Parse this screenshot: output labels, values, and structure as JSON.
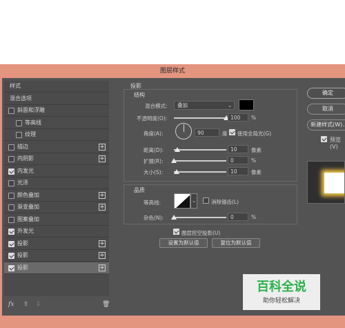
{
  "dialog": {
    "title": "图层样式"
  },
  "left_panel": {
    "items": [
      {
        "label": "样式",
        "has_checkbox": false,
        "checked": false,
        "has_plus": false
      },
      {
        "label": "混合选项",
        "has_checkbox": false,
        "checked": false,
        "has_plus": false
      },
      {
        "label": "斜面和浮雕",
        "has_checkbox": true,
        "checked": false,
        "has_plus": false
      },
      {
        "label": "等高线",
        "has_checkbox": true,
        "checked": false,
        "has_plus": false,
        "indent": true
      },
      {
        "label": "纹理",
        "has_checkbox": true,
        "checked": false,
        "has_plus": false,
        "indent": true
      },
      {
        "label": "描边",
        "has_checkbox": true,
        "checked": false,
        "has_plus": true
      },
      {
        "label": "内阴影",
        "has_checkbox": true,
        "checked": false,
        "has_plus": true
      },
      {
        "label": "内发光",
        "has_checkbox": true,
        "checked": true,
        "has_plus": false
      },
      {
        "label": "光泽",
        "has_checkbox": true,
        "checked": false,
        "has_plus": false
      },
      {
        "label": "颜色叠加",
        "has_checkbox": true,
        "checked": false,
        "has_plus": true
      },
      {
        "label": "渐变叠加",
        "has_checkbox": true,
        "checked": false,
        "has_plus": true
      },
      {
        "label": "图案叠加",
        "has_checkbox": true,
        "checked": false,
        "has_plus": false
      },
      {
        "label": "外发光",
        "has_checkbox": true,
        "checked": true,
        "has_plus": false
      },
      {
        "label": "投影",
        "has_checkbox": true,
        "checked": true,
        "has_plus": true
      },
      {
        "label": "投影",
        "has_checkbox": true,
        "checked": true,
        "has_plus": true
      },
      {
        "label": "投影",
        "has_checkbox": true,
        "checked": true,
        "has_plus": true,
        "selected": true
      }
    ],
    "footer": {
      "fx": "fx",
      "up": "⇧",
      "down": "⇩",
      "trash": "🗑"
    }
  },
  "shadow": {
    "section_title": "投影",
    "structure_title": "结构",
    "blend_mode_label": "混合模式:",
    "blend_mode_value": "叠加",
    "blend_color": "#000000",
    "opacity_label": "不透明度(O):",
    "opacity_value": "100",
    "opacity_unit": "%",
    "opacity_level": 1.0,
    "angle_label": "角度(A):",
    "angle_value": "90",
    "angle_unit": "度",
    "global_light_label": "使用全局光(G)",
    "global_light_checked": true,
    "distance_label": "距离(D):",
    "distance_value": "10",
    "distance_unit": "像素",
    "distance_level": 0.07,
    "spread_label": "扩展(R):",
    "spread_value": "0",
    "spread_unit": "%",
    "spread_level": 0.0,
    "size_label": "大小(S):",
    "size_value": "10",
    "size_unit": "像素",
    "size_level": 0.05,
    "quality_title": "品质",
    "contour_label": "等高线:",
    "antialias_label": "消除锯齿(L)",
    "antialias_checked": false,
    "noise_label": "杂色(N):",
    "noise_value": "0",
    "noise_unit": "%",
    "noise_level": 0.0,
    "knockout_label": "图层挖空投影(U)",
    "knockout_checked": true,
    "set_default_label": "设置为默认值",
    "reset_default_label": "复位为默认值"
  },
  "right_panel": {
    "ok_label": "确定",
    "cancel_label": "取消",
    "new_style_label": "新建样式(W)...",
    "preview_label": "预览(V)",
    "preview_checked": true,
    "glow_color": "#f3c544"
  },
  "watermark": {
    "title": "百科全说",
    "subtitle": "助你轻松解决"
  }
}
